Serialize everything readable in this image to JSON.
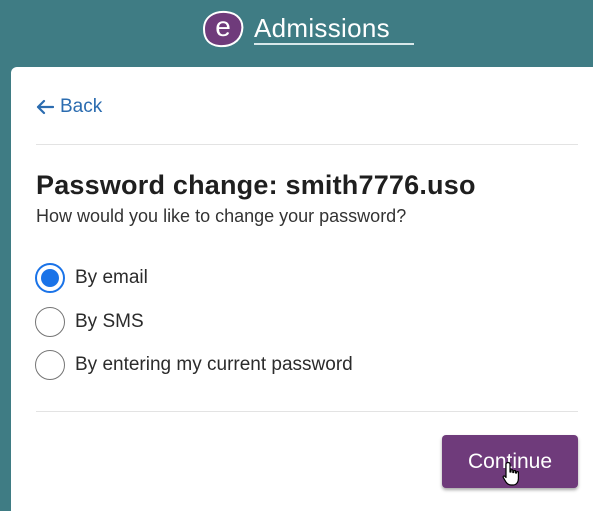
{
  "header": {
    "logo_letter": "e",
    "logo_text": "Admissions"
  },
  "nav": {
    "back_label": "Back"
  },
  "form": {
    "title": "Password change: smith7776.uso",
    "subtitle": "How would you like to change your password?",
    "options": [
      {
        "label": "By email",
        "selected": true
      },
      {
        "label": "By SMS",
        "selected": false
      },
      {
        "label": "By entering my current password",
        "selected": false
      }
    ],
    "continue_label": "Continue"
  },
  "colors": {
    "background": "#3f7c84",
    "brand_purple": "#6f3b7b",
    "link_blue": "#2b6cb0",
    "radio_selected": "#1a73e8"
  },
  "icons": [
    "back-arrow-icon",
    "hand-pointer-cursor-icon"
  ]
}
